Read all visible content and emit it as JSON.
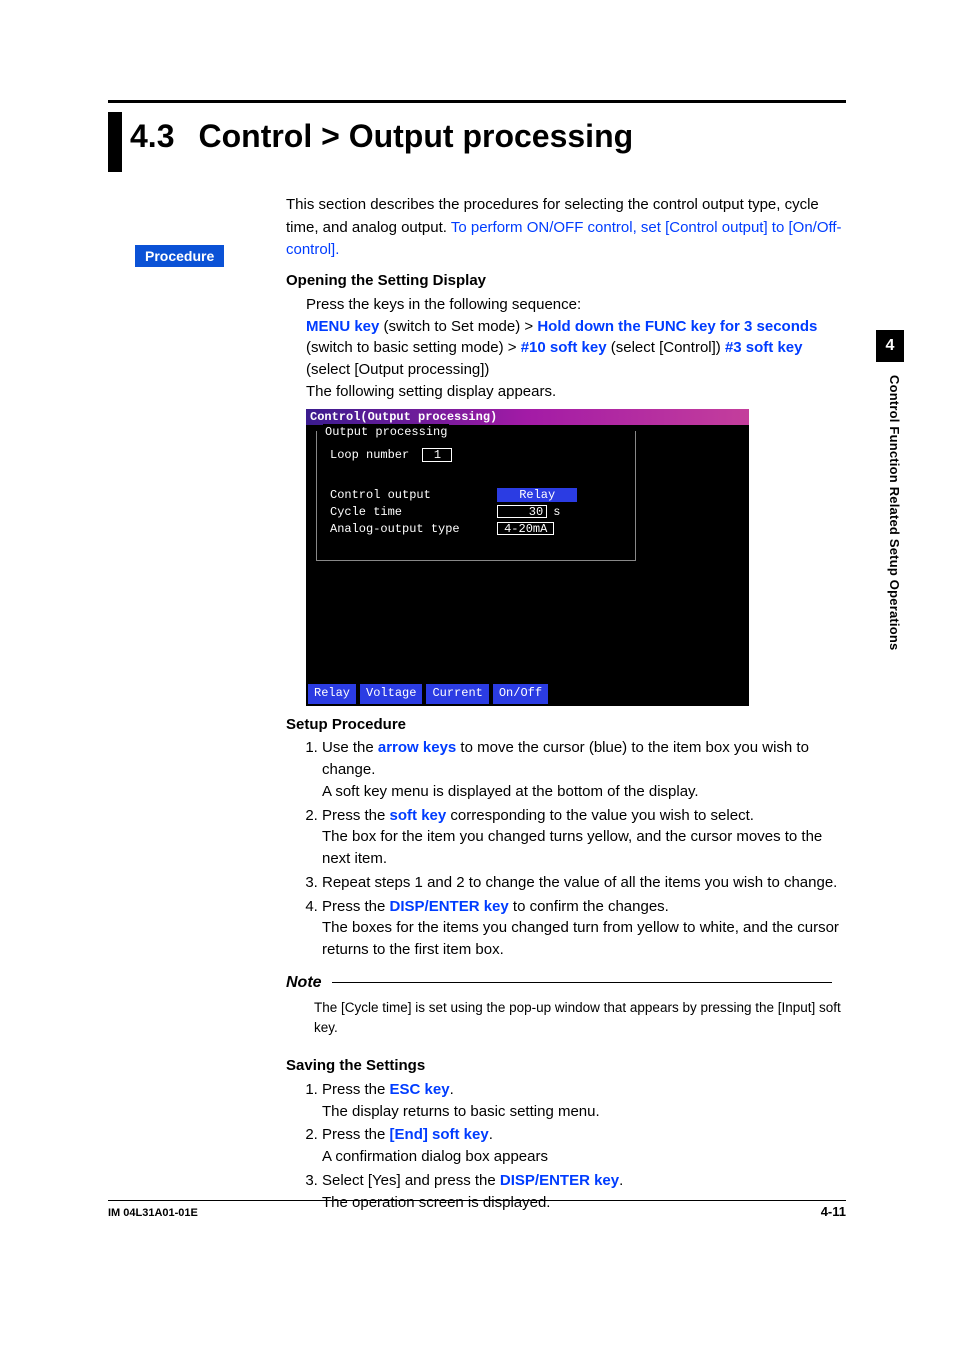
{
  "side_tab": "4",
  "side_caption": "Control Function Related Setup Operations",
  "section_number": "4.3",
  "section_title": "Control > Output processing",
  "intro_plain": "This section describes the procedures for selecting the control output type, cycle time, and analog output.  ",
  "intro_blue": "To perform ON/OFF control, set [Control output] to [On/Off-control].",
  "procedure_label": "Procedure",
  "opening_heading": "Opening the Setting Display",
  "opening_line1": "Press the keys in the following sequence:",
  "seq_menu_key": "MENU key",
  "seq_after_menu": " (switch to Set mode) > ",
  "seq_hold_func": "Hold down the FUNC key for 3 seconds",
  "seq_after_hold": " (switch to basic setting mode) > ",
  "seq_sk10": "#10 soft key",
  "seq_after_sk10": " (select [Control]) ",
  "seq_sk3": "#3 soft key",
  "seq_after_sk3": " (select [Output processing])",
  "opening_line3": "The following setting display appears.",
  "screenshot": {
    "title": "Control(Output processing)",
    "panel_legend": "Output processing",
    "loop_label": "Loop number",
    "loop_value": "1",
    "rows": [
      {
        "label": "Control output",
        "value": "Relay",
        "style": "highlight"
      },
      {
        "label": "Cycle time",
        "value": "30",
        "unit": "s",
        "style": "box"
      },
      {
        "label": "Analog-output type",
        "value": "4-20mA",
        "style": "box"
      }
    ],
    "softkeys": [
      "Relay",
      "Voltage",
      "Current",
      "On/Off"
    ]
  },
  "setup_heading": "Setup Procedure",
  "setup_steps": {
    "s1a": "Use the ",
    "s1key": "arrow keys",
    "s1b": " to move the cursor (blue) to the item box you wish to change.",
    "s1c": "A soft key menu is displayed at the bottom of the display.",
    "s2a": "Press the ",
    "s2key": "soft key",
    "s2b": " corresponding to the value you wish to select.",
    "s2c": "The box for the item you changed turns yellow, and the cursor moves to the next item.",
    "s3": "Repeat steps 1 and 2 to change the value of all the items you wish to change.",
    "s4a": "Press the ",
    "s4key": "DISP/ENTER key",
    "s4b": " to confirm the changes.",
    "s4c": "The boxes for the items you changed turn from yellow to white, and the cursor returns to the first item box."
  },
  "note_label": "Note",
  "note_text": "The [Cycle time] is set using the pop-up window that appears by pressing the [Input] soft key.",
  "saving_heading": "Saving the Settings",
  "saving_steps": {
    "s1a": "Press the ",
    "s1key": "ESC key",
    "s1b": ".",
    "s1c": "The display returns to basic setting menu.",
    "s2a": "Press the ",
    "s2key": "[End] soft key",
    "s2b": ".",
    "s2c": "A confirmation dialog box appears",
    "s3a": "Select [Yes] and press the ",
    "s3key": "DISP/ENTER key",
    "s3b": ".",
    "s3c": "The operation screen is displayed."
  },
  "footer_left": "IM 04L31A01-01E",
  "footer_right": "4-11"
}
